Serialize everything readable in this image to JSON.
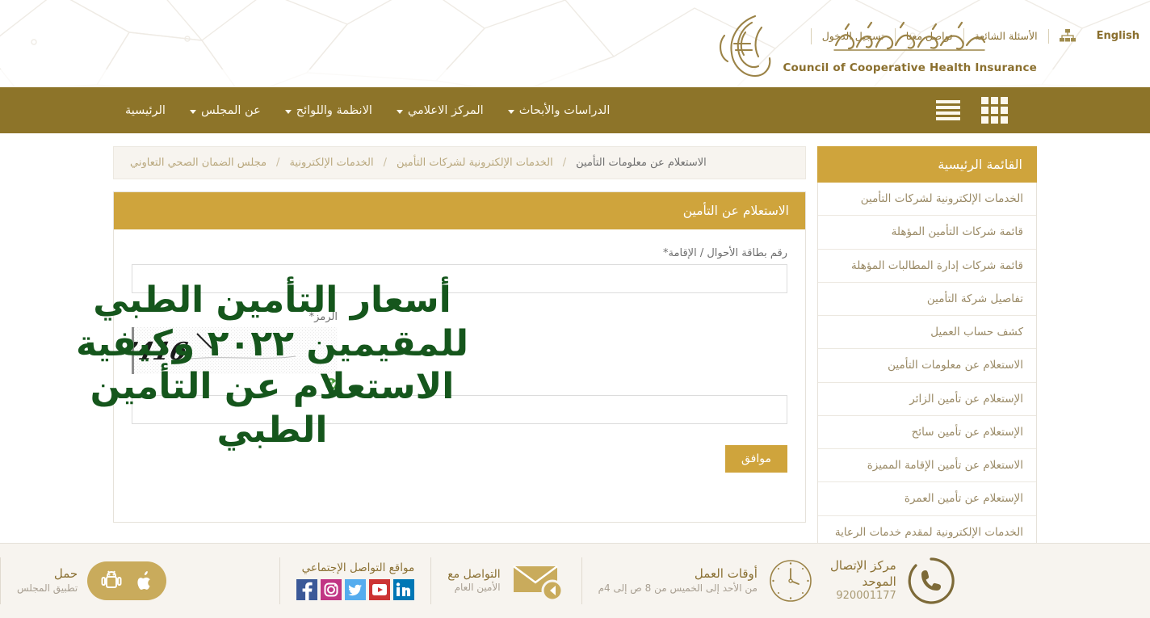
{
  "header": {
    "logo_en": "Council of Cooperative Health Insurance",
    "logo_ar": "مجلس الضمان الصحي التعاوني",
    "topnav": [
      {
        "label": "تسجيل الدخول",
        "name": "login"
      },
      {
        "label": "تواصل معنا",
        "name": "contact-us"
      },
      {
        "label": "الأسئلة الشائعة",
        "name": "faq"
      },
      {
        "label": "",
        "name": "sitemap",
        "icon": "sitemap-icon"
      },
      {
        "label": "English",
        "name": "english"
      }
    ]
  },
  "mainnav": {
    "items": [
      {
        "label": "الرئيسية",
        "name": "home",
        "caret": false
      },
      {
        "label": "عن المجلس",
        "name": "about-council",
        "caret": true
      },
      {
        "label": "الانظمة واللوائح",
        "name": "regulations",
        "caret": true
      },
      {
        "label": "المركز الاعلامي",
        "name": "media-center",
        "caret": true
      },
      {
        "label": "الدراسات والأبحاث",
        "name": "studies-research",
        "caret": true
      }
    ],
    "menu_icon": "hamburger-icon",
    "grid_icon": "grid-icon"
  },
  "breadcrumb": {
    "items": [
      "مجلس الضمان الصحي التعاوني",
      "الخدمات الإلكترونية",
      "الخدمات الإلكترونية لشركات التأمين",
      "الاستعلام عن معلومات التأمين"
    ],
    "separator": "/"
  },
  "sidebar": {
    "title": "القائمة الرئيسية",
    "items": [
      "الخدمات الإلكترونية لشركات التأمين",
      "قائمة شركات التأمين المؤهلة",
      "قائمة شركات إدارة المطالبات المؤهلة",
      "تفاصيل شركة التأمين",
      "كشف حساب العميل",
      "الاستعلام عن معلومات التأمين",
      "الإستعلام عن تأمين الزائر",
      "الإستعلام عن تأمين سائح",
      "الاستعلام عن تأمين الإقامة المميزة",
      "الإستعلام عن تأمين العمرة",
      "الخدمات الإلكترونية لمقدم خدمات الرعاية الصحية"
    ]
  },
  "form": {
    "panel_title": "الاستعلام عن التأمين",
    "id_label": "رقم بطاقة الأحوال / الإقامة*",
    "id_value": "",
    "id_placeholder": "",
    "captcha_label": "الرمز*",
    "captcha_text": "257416",
    "captcha_value": "",
    "refresh_icon": "refresh-icon",
    "submit_label": "موافق"
  },
  "overlay": {
    "headline": "أسعار التأمين الطبي للمقيمين ٢٠٢٢ وكيفية الاستعلام عن التأمين الطبي",
    "color": "#15561c"
  },
  "footer": {
    "app": {
      "line1": "حمل",
      "line2": "تطبيق المجلس",
      "apple_icon": "apple-icon",
      "android_icon": "android-icon"
    },
    "social": {
      "title": "مواقع التواصل الإجتماعي",
      "items": [
        {
          "name": "facebook-icon",
          "color": "#3b5998",
          "glyph": "f"
        },
        {
          "name": "instagram-icon",
          "color": "#c13584",
          "glyph": "◎"
        },
        {
          "name": "twitter-icon",
          "color": "#55acee",
          "glyph": "t"
        },
        {
          "name": "youtube-icon",
          "color": "#cc3333",
          "glyph": "▶"
        },
        {
          "name": "linkedin-icon",
          "color": "#0077b5",
          "glyph": "in"
        }
      ]
    },
    "contact": {
      "line1": "التواصل مع",
      "line2": "الأمين العام",
      "icon": "envelope-icon"
    },
    "hours": {
      "line1": "أوقات العمل",
      "line2": "من الأحد إلى الخميس من 8 ص إلى 4م",
      "icon": "clock-icon"
    },
    "callcenter": {
      "line1": "مركز الإتصال",
      "line2": "الموحد",
      "number": "920001177",
      "icon": "phone-icon"
    }
  },
  "colors": {
    "gold_dark": "#8d7429",
    "gold": "#cfa43c",
    "gold_text": "#8a7033",
    "cream": "#f7f4ef",
    "green": "#15561c"
  }
}
